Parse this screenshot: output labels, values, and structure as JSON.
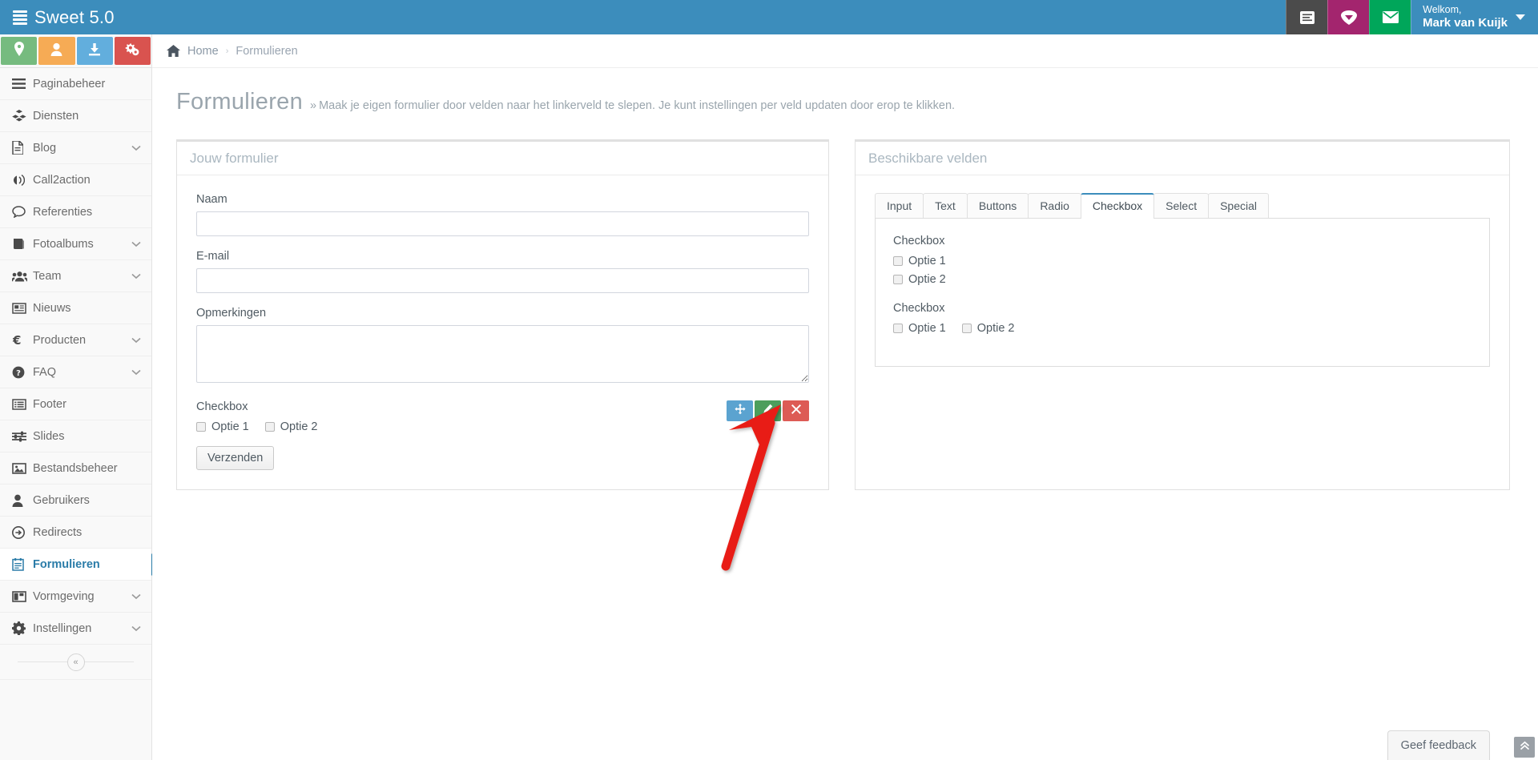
{
  "topbar": {
    "brand": "Sweet 5.0",
    "brand_icon": "stacked-lines-icon",
    "buttons": [
      {
        "name": "notes-icon",
        "color": "#4b4b4b"
      },
      {
        "name": "diamond-icon",
        "color": "#a3256e"
      },
      {
        "name": "envelope-icon",
        "color": "#00a65a"
      }
    ],
    "user": {
      "greeting": "Welkom,",
      "name": "Mark van Kuijk"
    }
  },
  "sidebar": {
    "quick_actions": [
      {
        "name": "map-marker-icon",
        "color": "#76bb7f"
      },
      {
        "name": "user-icon",
        "color": "#f6ab55"
      },
      {
        "name": "download-icon",
        "color": "#62aedd"
      },
      {
        "name": "gears-icon",
        "color": "#d9534f"
      }
    ],
    "items": [
      {
        "label": "Paginabeheer",
        "icon": "bars-icon",
        "chevron": false,
        "active": false
      },
      {
        "label": "Diensten",
        "icon": "cubes-icon",
        "chevron": false,
        "active": false
      },
      {
        "label": "Blog",
        "icon": "file-text-icon",
        "chevron": true,
        "active": false
      },
      {
        "label": "Call2action",
        "icon": "bullhorn-icon",
        "chevron": false,
        "active": false
      },
      {
        "label": "Referenties",
        "icon": "comment-icon",
        "chevron": false,
        "active": false
      },
      {
        "label": "Fotoalbums",
        "icon": "book-icon",
        "chevron": true,
        "active": false
      },
      {
        "label": "Team",
        "icon": "users-icon",
        "chevron": true,
        "active": false
      },
      {
        "label": "Nieuws",
        "icon": "newspaper-icon",
        "chevron": false,
        "active": false
      },
      {
        "label": "Producten",
        "icon": "euro-icon",
        "chevron": true,
        "active": false
      },
      {
        "label": "FAQ",
        "icon": "question-icon",
        "chevron": true,
        "active": false
      },
      {
        "label": "Footer",
        "icon": "list-alt-icon",
        "chevron": false,
        "active": false
      },
      {
        "label": "Slides",
        "icon": "sliders-icon",
        "chevron": false,
        "active": false
      },
      {
        "label": "Bestandsbeheer",
        "icon": "image-icon",
        "chevron": false,
        "active": false
      },
      {
        "label": "Gebruikers",
        "icon": "user-icon",
        "chevron": false,
        "active": false
      },
      {
        "label": "Redirects",
        "icon": "arrow-circle-icon",
        "chevron": false,
        "active": false
      },
      {
        "label": "Formulieren",
        "icon": "form-icon",
        "chevron": false,
        "active": true
      },
      {
        "label": "Vormgeving",
        "icon": "columns-icon",
        "chevron": true,
        "active": false
      },
      {
        "label": "Instellingen",
        "icon": "gear-icon",
        "chevron": true,
        "active": false
      }
    ],
    "collapse_label": "«"
  },
  "breadcrumb": {
    "home_icon": "home-icon",
    "home": "Home",
    "separator": "›",
    "current": "Formulieren"
  },
  "page": {
    "title": "Formulieren",
    "subtitle_chevron": "»",
    "subtitle": "Maak je eigen formulier door velden naar het linkerveld te slepen. Je kunt instellingen per veld updaten door erop te klikken."
  },
  "form_panel": {
    "title": "Jouw formulier",
    "fields": [
      {
        "label": "Naam",
        "type": "text",
        "value": "",
        "placeholder": ""
      },
      {
        "label": "E-mail",
        "type": "text",
        "value": "",
        "placeholder": ""
      },
      {
        "label": "Opmerkingen",
        "type": "textarea",
        "value": "",
        "placeholder": ""
      }
    ],
    "checkbox_field": {
      "legend": "Checkbox",
      "options": [
        {
          "label": "Optie 1",
          "checked": false
        },
        {
          "label": "Optie 2",
          "checked": false
        }
      ],
      "actions": [
        {
          "name": "move-handle",
          "icon": "arrows-move-icon",
          "color": "#5ba3d0"
        },
        {
          "name": "edit-field",
          "icon": "pencil-icon",
          "color": "#4c9e5c"
        },
        {
          "name": "delete-field",
          "icon": "times-icon",
          "color": "#dd5b55"
        }
      ]
    },
    "submit_label": "Verzenden"
  },
  "fields_panel": {
    "title": "Beschikbare velden",
    "tabs": [
      {
        "label": "Input",
        "active": false
      },
      {
        "label": "Text",
        "active": false
      },
      {
        "label": "Buttons",
        "active": false
      },
      {
        "label": "Radio",
        "active": false
      },
      {
        "label": "Checkbox",
        "active": true
      },
      {
        "label": "Select",
        "active": false
      },
      {
        "label": "Special",
        "active": false
      }
    ],
    "available": [
      {
        "legend": "Checkbox",
        "layout": "stacked",
        "options": [
          {
            "label": "Optie 1",
            "checked": false
          },
          {
            "label": "Optie 2",
            "checked": false
          }
        ]
      },
      {
        "legend": "Checkbox",
        "layout": "inline",
        "options": [
          {
            "label": "Optie 1",
            "checked": false
          },
          {
            "label": "Optie 2",
            "checked": false
          }
        ]
      }
    ]
  },
  "footer_widgets": {
    "feedback_label": "Geef feedback",
    "to_top_icon": "chevron-up-double-icon"
  },
  "annotation": {
    "type": "arrow",
    "color": "#e81c12",
    "points_at": "edit-field",
    "from": [
      907,
      706
    ],
    "to": [
      976,
      508
    ]
  },
  "colors": {
    "brand_blue": "#3c8dbc",
    "active_blue": "#2b7ca8",
    "panel_border": "#e0e0e0",
    "accent_red": "#e81c12"
  }
}
